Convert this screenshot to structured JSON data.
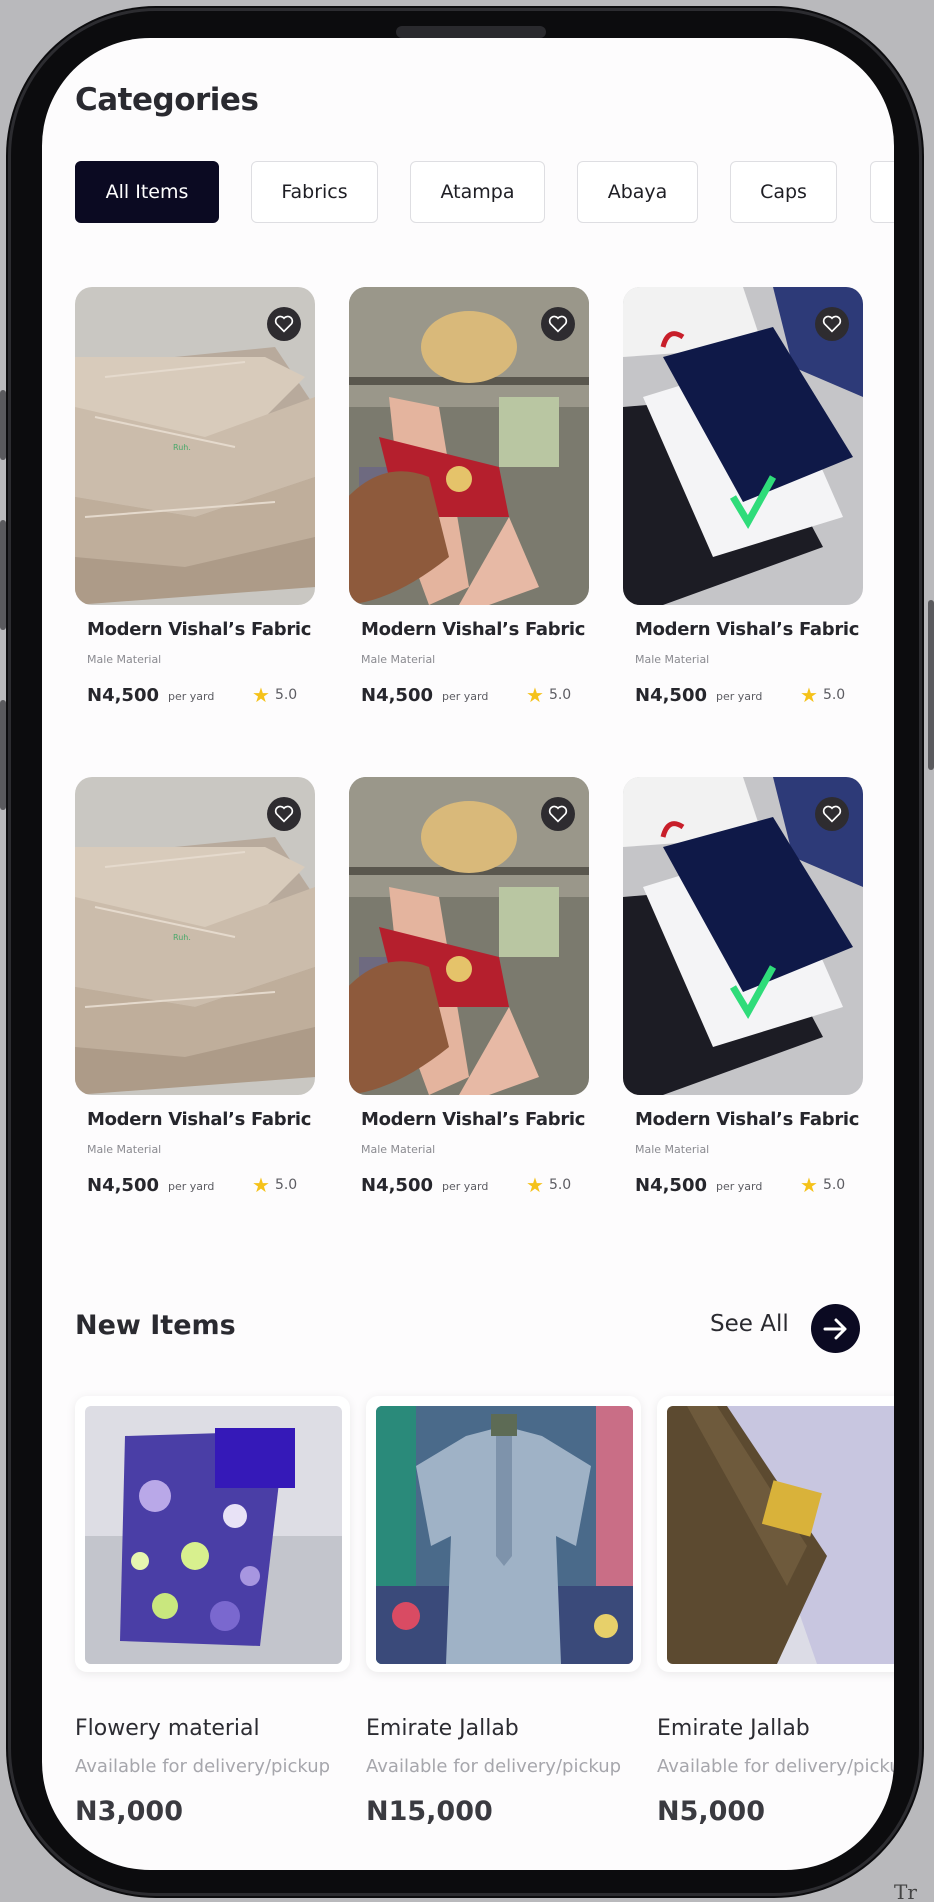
{
  "header": {
    "title": "Categories"
  },
  "categories": [
    "All Items",
    "Fabrics",
    "Atampa",
    "Abaya",
    "Caps"
  ],
  "products": [
    {
      "name": "Modern Vishal’s Fabric",
      "subtitle": "Male Material",
      "price": "N4,500",
      "unit": "per yard",
      "rating": "5.0",
      "image": "satin-fabric"
    },
    {
      "name": "Modern Vishal’s Fabric",
      "subtitle": "Male Material",
      "price": "N4,500",
      "unit": "per yard",
      "rating": "5.0",
      "image": "red-sandal"
    },
    {
      "name": "Modern Vishal’s Fabric",
      "subtitle": "Male Material",
      "price": "N4,500",
      "unit": "per yard",
      "rating": "5.0",
      "image": "tudor-fabric"
    },
    {
      "name": "Modern Vishal’s Fabric",
      "subtitle": "Male Material",
      "price": "N4,500",
      "unit": "per yard",
      "rating": "5.0",
      "image": "satin-fabric"
    },
    {
      "name": "Modern Vishal’s Fabric",
      "subtitle": "Male Material",
      "price": "N4,500",
      "unit": "per yard",
      "rating": "5.0",
      "image": "red-sandal"
    },
    {
      "name": "Modern Vishal’s Fabric",
      "subtitle": "Male Material",
      "price": "N4,500",
      "unit": "per yard",
      "rating": "5.0",
      "image": "tudor-fabric"
    }
  ],
  "new_items": {
    "title": "New Items",
    "see_all": "See All",
    "items": [
      {
        "name": "Flowery material",
        "availability": "Available for delivery/pickup",
        "price": "N3,000",
        "image": "floral-fabric"
      },
      {
        "name": "Emirate Jallab",
        "availability": "Available for delivery/pickup",
        "price": "N15,000",
        "image": "jallab-robe"
      },
      {
        "name": "Emirate Jallab",
        "availability": "Available for delivery/pickup",
        "price": "N5,000",
        "image": "brown-fabric"
      }
    ]
  },
  "corner_text": "Tr",
  "colors": {
    "accent": "#0b0a22",
    "star": "#f5c21a"
  }
}
